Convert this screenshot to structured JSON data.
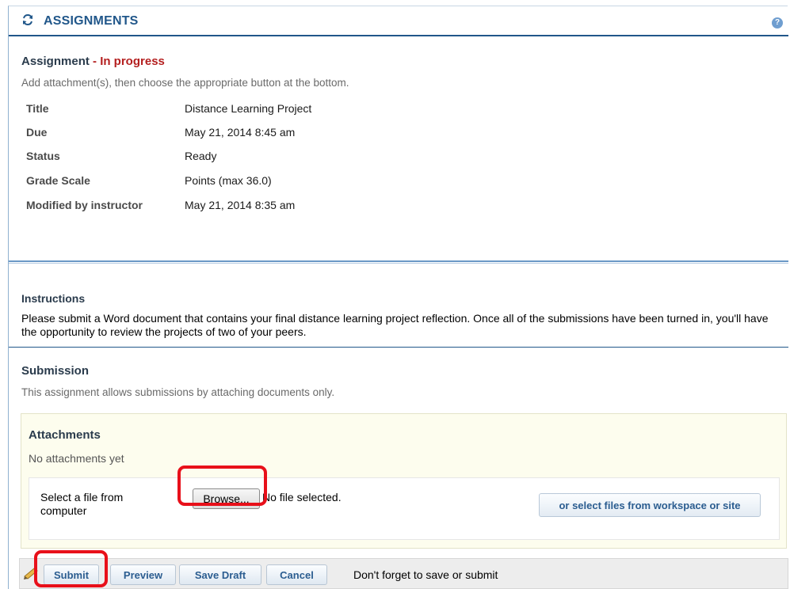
{
  "header": {
    "title": "ASSIGNMENTS",
    "icon": "sync-icon",
    "help_icon": "help-icon",
    "help_glyph": "?",
    "accent_color": "#21578a"
  },
  "assignment": {
    "heading": "Assignment",
    "state": " - In progress",
    "hint": "Add attachment(s), then choose the appropriate button at the bottom.",
    "properties": [
      {
        "label": "Title",
        "value": "Distance Learning Project"
      },
      {
        "label": "Due",
        "value": "May 21, 2014 8:45 am"
      },
      {
        "label": "Status",
        "value": "Ready"
      },
      {
        "label": "Grade Scale",
        "value": "Points (max 36.0)"
      },
      {
        "label": "Modified by instructor",
        "value": "May 21, 2014 8:35 am"
      }
    ]
  },
  "instructions": {
    "heading": "Instructions",
    "text": "Please submit a Word document that contains your final distance learning project reflection.  Once all of the submissions have been turned in, you'll have the opportunity to review the projects of two of your peers."
  },
  "submission": {
    "heading": "Submission",
    "hint": "This assignment allows submissions by attaching documents only."
  },
  "attachments": {
    "title": "Attachments",
    "empty_text": "No attachments yet",
    "select_label": "Select a file from computer",
    "browse_label": "Browse...",
    "file_status": "No file selected.",
    "workspace_button": "or select files from workspace or site"
  },
  "actions": {
    "icon": "pencil-icon",
    "submit": "Submit",
    "preview": "Preview",
    "save_draft": "Save Draft",
    "cancel": "Cancel",
    "note": "Don't forget to save or submit"
  },
  "colors": {
    "accent": "#21578a",
    "state_red": "#b41f1f",
    "highlight_red": "#e8101a",
    "attach_bg": "#fdfdee"
  }
}
